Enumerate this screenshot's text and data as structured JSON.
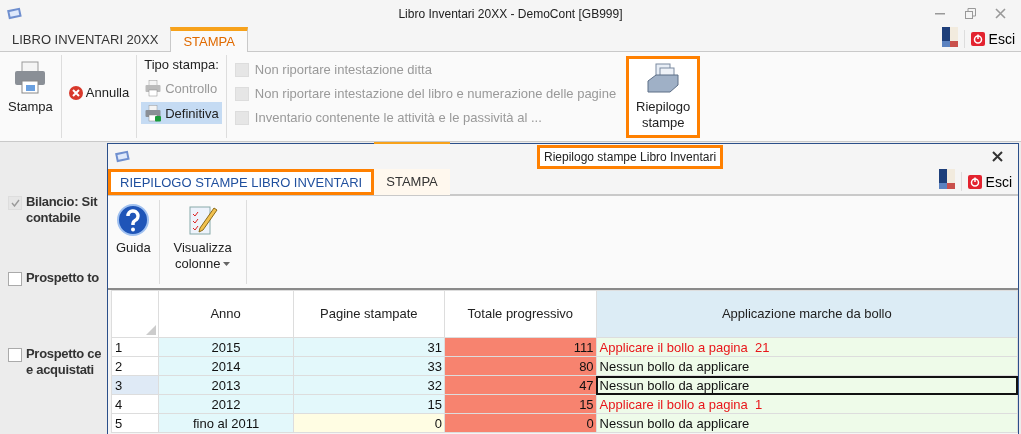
{
  "window": {
    "title": "Libro Inventari 20XX - DemoCont [GB999]"
  },
  "tabs": [
    {
      "label": "LIBRO INVENTARI 20XX",
      "selected": false,
      "contextual": false
    },
    {
      "label": "STAMPA",
      "selected": true,
      "contextual": true
    }
  ],
  "exit_button": {
    "label": "Esci"
  },
  "ribbon": {
    "print_button": {
      "label": "Stampa"
    },
    "cancel_button": {
      "label": "Annulla"
    },
    "print_type": {
      "label": "Tipo stampa:",
      "options": [
        {
          "label": "Controllo",
          "selected": false,
          "disabled": true
        },
        {
          "label": "Definitiva",
          "selected": true,
          "disabled": false
        }
      ]
    },
    "options": [
      {
        "label": "Non riportare intestazione ditta",
        "checked": false,
        "disabled": true
      },
      {
        "label": "Non riportare intestazione del libro e numerazione delle pagine",
        "checked": false,
        "disabled": true
      },
      {
        "label": "Inventario contenente le attività e le passività al ...",
        "checked": false,
        "disabled": true
      }
    ],
    "summary_button": {
      "label": "Riepilogo stampe",
      "highlighted": true
    }
  },
  "background_items": [
    {
      "lines": [
        "Bilancio: Sit",
        "contabile"
      ],
      "checked": true,
      "disabled": true
    },
    {
      "lines": [
        "Prospetto to"
      ],
      "checked": false,
      "disabled": false
    },
    {
      "lines": [
        "Prospetto ce",
        "e acquistati"
      ],
      "checked": false,
      "disabled": false
    }
  ],
  "dialog": {
    "title": "Riepilogo stampe Libro Inventari",
    "title_highlighted": true,
    "tabs": [
      {
        "label": "RIEPILOGO STAMPE LIBRO INVENTARI",
        "selected": true,
        "contextual": false,
        "highlighted": true
      },
      {
        "label": "STAMPA",
        "selected": false,
        "contextual": true,
        "highlighted": false
      }
    ],
    "exit_button": {
      "label": "Esci"
    },
    "ribbon": [
      {
        "kind": "help",
        "label": "Guida",
        "dropdown": false
      },
      {
        "kind": "columns",
        "label": "Visualizza colonne",
        "dropdown": true
      }
    ],
    "table": {
      "columns": [
        "Anno",
        "Pagine stampate",
        "Totale progressivo",
        "Applicazione marche da bollo"
      ],
      "rows": [
        {
          "number": "1",
          "year": "2015",
          "pages": {
            "text": "31",
            "color": "#e3f8fb"
          },
          "total": "111",
          "stamp": "Applicare il bollo a pagina  21",
          "stamp_alert": true,
          "selected": false
        },
        {
          "number": "2",
          "year": "2014",
          "pages": {
            "text": "33",
            "color": "#e3f8fb"
          },
          "total": "80",
          "stamp": "Nessun bollo da applicare",
          "stamp_alert": false,
          "selected": false
        },
        {
          "number": "3",
          "year": "2013",
          "pages": {
            "text": "32",
            "color": "#e3f8fb"
          },
          "total": "47",
          "stamp": "Nessun bollo da applicare",
          "stamp_alert": false,
          "selected": true
        },
        {
          "number": "4",
          "year": "2012",
          "pages": {
            "text": "15",
            "color": "#e3f8fb"
          },
          "total": "15",
          "stamp": "Applicare il bollo a pagina  1",
          "stamp_alert": true,
          "selected": false
        },
        {
          "number": "5",
          "year": "fino al 2011",
          "pages": {
            "text": "0",
            "color": "#fffde3"
          },
          "total": "0",
          "stamp": "Nessun bollo da applicare",
          "stamp_alert": false,
          "selected": false
        }
      ]
    }
  }
}
